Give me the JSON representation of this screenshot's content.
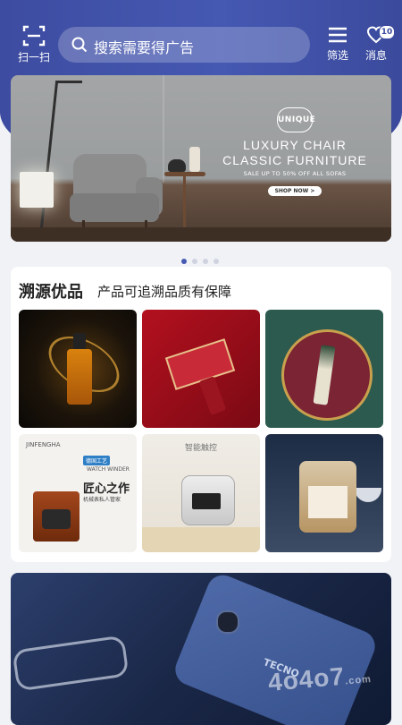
{
  "header": {
    "scan_label": "扫一扫",
    "search_placeholder": "搜索需要得广告",
    "filter_label": "筛选",
    "message_label": "消息",
    "message_badge": "10"
  },
  "banner": {
    "seal_text": "UNIQUE",
    "title_line1": "LUXURY CHAIR",
    "title_line2": "CLASSIC FURNITURE",
    "subtitle": "SALE UP TO 50% OFF ALL SOFAS",
    "button_label": "SHOP NOW >",
    "dots_total": 4,
    "active_dot": 0
  },
  "section": {
    "title": "溯源优品",
    "subtitle": "产品可追溯品质有保障",
    "products": [
      {
        "name": "serum-bottle"
      },
      {
        "name": "lipstick-box"
      },
      {
        "name": "cream-tube"
      },
      {
        "name": "watch-winder",
        "brand": "JINFENGHA",
        "tag": "德国工艺",
        "line1": "WATCH WINDER",
        "headline": "匠心之作",
        "line2": "机械表私人管家"
      },
      {
        "name": "smart-cooker",
        "headline": "智能触控"
      },
      {
        "name": "sauce-jar"
      }
    ]
  },
  "bottom_banner": {
    "phone_brand": "TECNO"
  },
  "watermark": {
    "text": "4o4o7",
    "suffix": ".com"
  },
  "colors": {
    "header_blue": "#4558b2",
    "page_bg": "#f1f2f6",
    "active_dot": "#4558b2",
    "inactive_dot": "#cfd3e0"
  }
}
